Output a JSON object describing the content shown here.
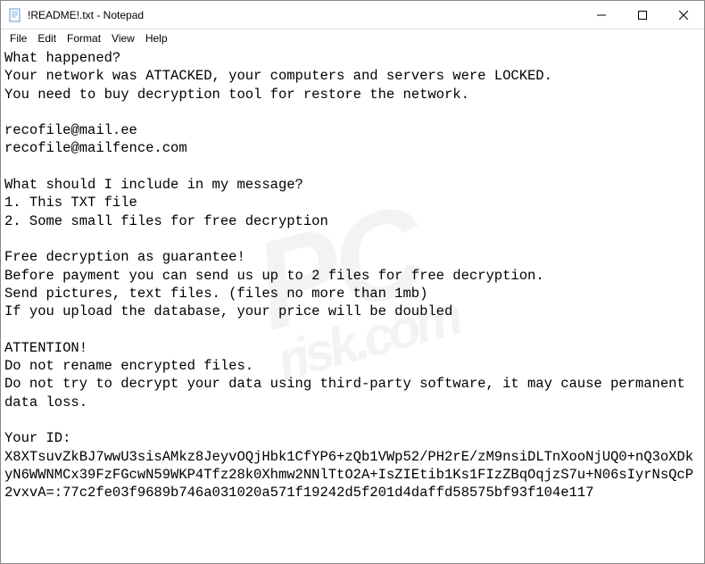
{
  "titlebar": {
    "title": "!README!.txt - Notepad"
  },
  "menu": {
    "file": "File",
    "edit": "Edit",
    "format": "Format",
    "view": "View",
    "help": "Help"
  },
  "content": {
    "text": "What happened?\nYour network was ATTACKED, your computers and servers were LOCKED.\nYou need to buy decryption tool for restore the network.\n\nrecofile@mail.ee\nrecofile@mailfence.com\n\nWhat should I include in my message?\n1. This TXT file\n2. Some small files for free decryption\n\nFree decryption as guarantee!\nBefore payment you can send us up to 2 files for free decryption.\nSend pictures, text files. (files no more than 1mb)\nIf you upload the database, your price will be doubled\n\nATTENTION!\nDo not rename encrypted files.\nDo not try to decrypt your data using third-party software, it may cause permanent data loss.\n\nYour ID:\nX8XTsuvZkBJ7wwU3sisAMkz8JeyvOQjHbk1CfYP6+zQb1VWp52/PH2rE/zM9nsiDLTnXooNjUQ0+nQ3oXDkyN6WWNMCx39FzFGcwN59WKP4Tfz28k0Xhmw2NNlTtO2A+IsZIEtib1Ks1FIzZBqOqjzS7u+N06sIyrNsQcP2vxvA=:77c2fe03f9689b746a031020a571f19242d5f201d4daffd58575bf93f104e117"
  },
  "watermark": {
    "main": "PC",
    "sub": "risk.com"
  }
}
